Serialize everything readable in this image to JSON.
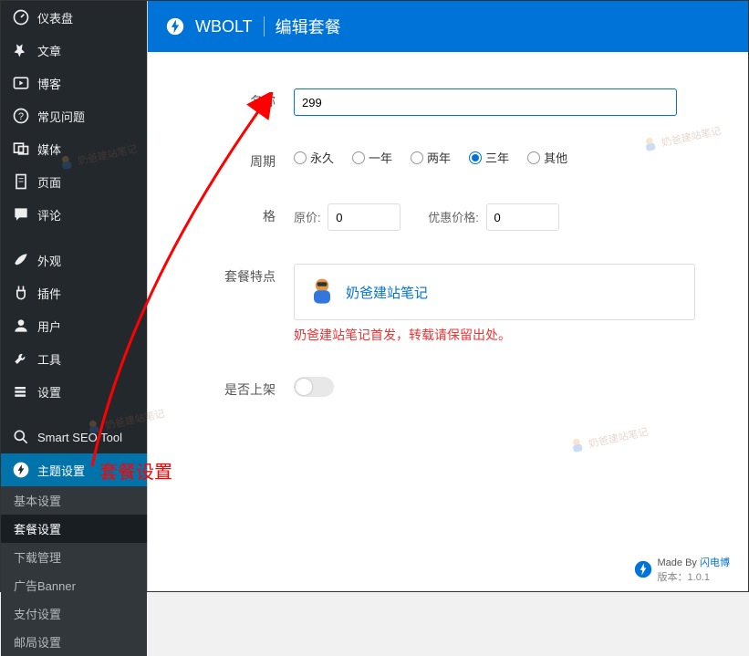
{
  "sidebar": {
    "menu": [
      {
        "icon": "dashboard",
        "label": "仪表盘"
      },
      {
        "icon": "pin",
        "label": "文章"
      },
      {
        "icon": "play",
        "label": "博客"
      },
      {
        "icon": "help",
        "label": "常见问题"
      },
      {
        "icon": "media",
        "label": "媒体"
      },
      {
        "icon": "page",
        "label": "页面"
      },
      {
        "icon": "comment",
        "label": "评论"
      },
      {
        "icon": "brush",
        "label": "外观"
      },
      {
        "icon": "plugin",
        "label": "插件"
      },
      {
        "icon": "user",
        "label": "用户"
      },
      {
        "icon": "tool",
        "label": "工具"
      },
      {
        "icon": "settings",
        "label": "设置"
      },
      {
        "icon": "seo",
        "label": "Smart SEO Tool"
      },
      {
        "icon": "bolt",
        "label": "主题设置",
        "active": true
      }
    ],
    "submenu": [
      {
        "label": "基本设置"
      },
      {
        "label": "套餐设置",
        "active": true
      },
      {
        "label": "下载管理"
      },
      {
        "label": "广告Banner"
      },
      {
        "label": "支付设置"
      },
      {
        "label": "邮局设置"
      }
    ]
  },
  "header": {
    "brand": "WBOLT",
    "title": "编辑套餐"
  },
  "form": {
    "name_label": "名称",
    "name_value": "299",
    "cycle_label": "周期",
    "cycle_options": [
      "永久",
      "一年",
      "两年",
      "三年",
      "其他"
    ],
    "cycle_selected": "三年",
    "price_section_label": "格",
    "orig_price_label": "原价:",
    "orig_price_value": "0",
    "disc_price_label": "优惠价格:",
    "disc_price_value": "0",
    "feature_label": "套餐特点",
    "feature_linktext": "奶爸建站笔记",
    "feature_note": "奶爸建站笔记首发，转载请保留出处。",
    "onsale_label": "是否上架"
  },
  "annotation": {
    "text": "套餐设置"
  },
  "footer": {
    "made_by": "Made By",
    "brand": "闪电博",
    "version_label": "版本：",
    "version": "1.0.1"
  },
  "watermark": "奶爸建站笔记"
}
